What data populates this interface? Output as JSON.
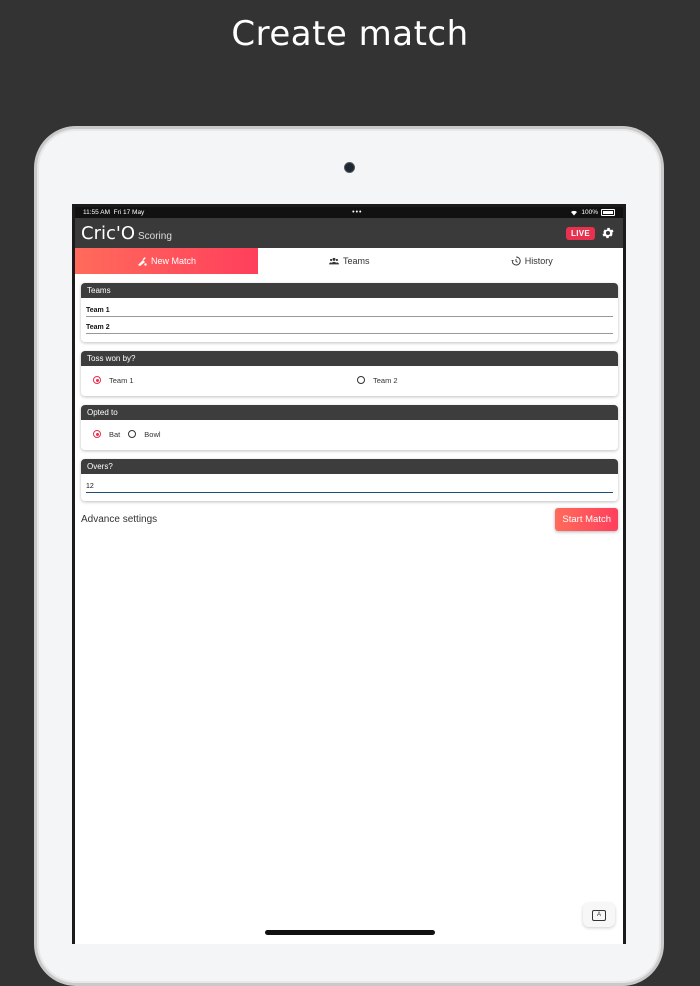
{
  "headline": "Create match",
  "status_bar": {
    "time": "11:55 AM",
    "date": "Fri 17 May",
    "dots": "•••",
    "battery": "100%"
  },
  "app_bar": {
    "title": "Cric'O",
    "subtitle": "Scoring",
    "live_label": "LIVE"
  },
  "tabs": [
    {
      "label": "New Match",
      "icon": "cricket-bat-icon",
      "active": true
    },
    {
      "label": "Teams",
      "icon": "people-icon",
      "active": false
    },
    {
      "label": "History",
      "icon": "history-icon",
      "active": false
    }
  ],
  "teams_card": {
    "title": "Teams",
    "team1": "Team 1",
    "team2": "Team 2"
  },
  "toss_card": {
    "title": "Toss won by?",
    "option1": "Team 1",
    "option2": "Team 2",
    "selected": "Team 1"
  },
  "opted_card": {
    "title": "Opted to",
    "option1": "Bat",
    "option2": "Bowl",
    "selected": "Bat"
  },
  "overs_card": {
    "title": "Overs?",
    "value": "12"
  },
  "footer": {
    "advance_settings": "Advance settings",
    "start_match": "Start Match"
  },
  "colors": {
    "accent": "#ff4a5c",
    "bar": "#3a3a3a",
    "background": "#333333"
  }
}
